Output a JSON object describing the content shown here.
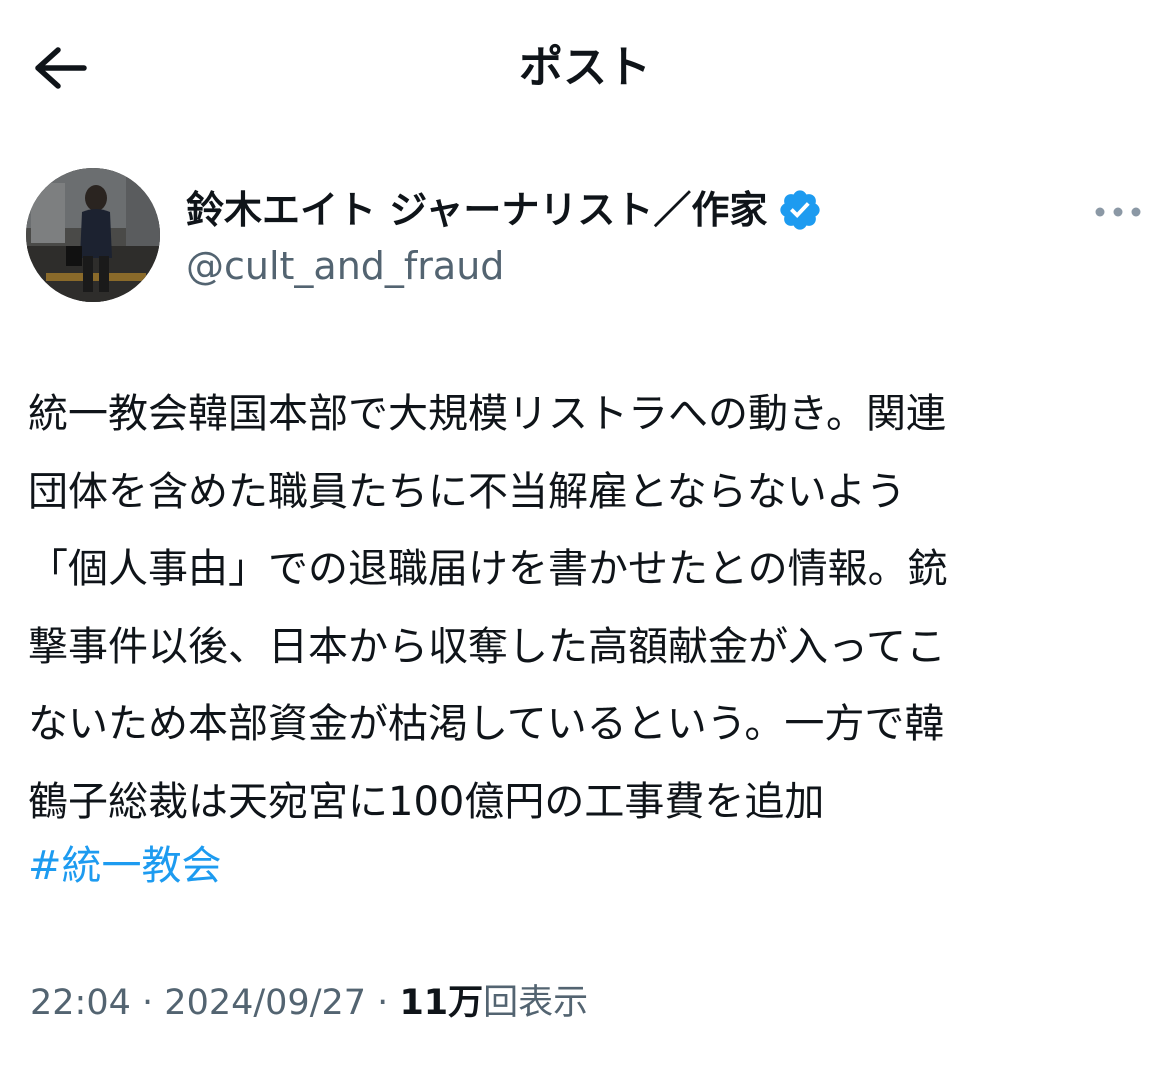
{
  "header": {
    "title": "ポスト",
    "back_icon": "arrow-left-icon"
  },
  "author": {
    "display_name": "鈴木エイト ジャーナリスト／作家",
    "handle": "@cult_and_fraud",
    "verified": true,
    "verified_color": "#1d9bf0",
    "more_icon": "more-dots-icon"
  },
  "tweet": {
    "lines": [
      "統一教会韓国本部で大規模リストラへの動き。関連",
      "団体を含めた職員たちに不当解雇とならないよう",
      "「個人事由」での退職届けを書かせたとの情報。銃",
      "撃事件以後、日本から収奪した高額献金が入ってこ",
      "ないため本部資金が枯渇しているという。一方で韓",
      "鶴子総裁は天宛宮に100億円の工事費を追加"
    ],
    "hashtag": "#統一教会",
    "hashtag_color": "#1d9bf0"
  },
  "meta": {
    "time": "22:04",
    "separator": "·",
    "date": "2024/09/27",
    "views_count": "11万",
    "views_label": "回表示"
  }
}
